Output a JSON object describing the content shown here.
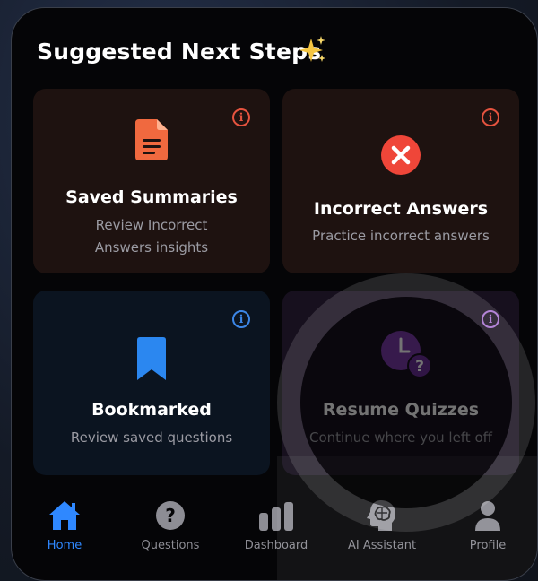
{
  "section": {
    "title": "Suggested Next Steps"
  },
  "cards": [
    {
      "title": "Saved Summaries",
      "subtitle_line1": "Review Incorrect",
      "subtitle_line2": "Answers insights",
      "icon": "document-icon",
      "accent": "#f0693f"
    },
    {
      "title": "Incorrect Answers",
      "subtitle_line1": "Practice incorrect answers",
      "icon": "x-circle-icon",
      "accent": "#ef4639"
    },
    {
      "title": "Bookmarked",
      "subtitle_line1": "Review saved questions",
      "icon": "bookmark-icon",
      "accent": "#2b87f0"
    },
    {
      "title": "Resume Quizzes",
      "subtitle_line1": "Continue where you left off",
      "icon": "clock-question-icon",
      "accent": "#7a3aa8"
    }
  ],
  "tabs": [
    {
      "label": "Home",
      "icon": "home-icon",
      "active": true
    },
    {
      "label": "Questions",
      "icon": "question-circle-icon",
      "active": false
    },
    {
      "label": "Dashboard",
      "icon": "bar-chart-icon",
      "active": false
    },
    {
      "label": "AI Assistant",
      "icon": "brain-head-icon",
      "active": false
    },
    {
      "label": "Profile",
      "icon": "person-icon",
      "active": false
    }
  ],
  "colors": {
    "active_tab": "#2f88ff",
    "inactive_tab": "#8d8d94",
    "background": "#050507"
  }
}
